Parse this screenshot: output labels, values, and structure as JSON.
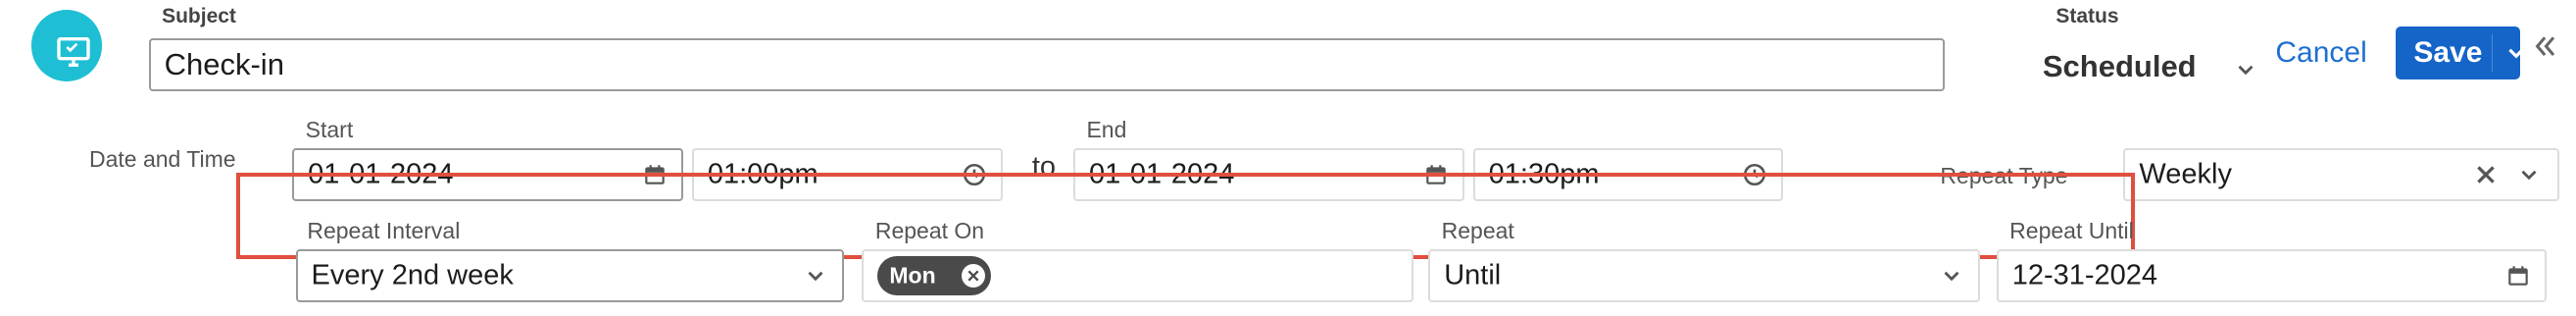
{
  "header": {
    "subject_label": "Subject",
    "subject_value": "Check-in",
    "status_label": "Status",
    "status_value": "Scheduled",
    "cancel_label": "Cancel",
    "save_label": "Save"
  },
  "date_time": {
    "section_label": "Date and Time",
    "start_label": "Start",
    "start_date": "01-01-2024",
    "start_time": "01:00pm",
    "to_label": "to",
    "end_label": "End",
    "end_date": "01-01-2024",
    "end_time": "01:30pm",
    "repeat_type_label": "Repeat Type",
    "repeat_type_value": "Weekly"
  },
  "repeat": {
    "interval_label": "Repeat Interval",
    "interval_value": "Every 2nd week",
    "on_label": "Repeat On",
    "on_values": [
      "Mon"
    ],
    "repeat_label": "Repeat",
    "repeat_value": "Until",
    "until_label": "Repeat Until",
    "until_value": "12-31-2024"
  },
  "colors": {
    "accent": "#1565c8",
    "avatar": "#1ebfd4",
    "highlight": "#e04f3f",
    "link": "#1f6fd1"
  },
  "icons": [
    "monitor-icon",
    "calendar-icon",
    "clock-icon",
    "chevron-down-icon",
    "clear-icon",
    "collapse-icon"
  ]
}
